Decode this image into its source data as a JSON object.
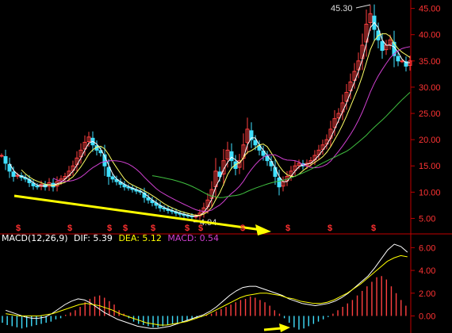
{
  "colors": {
    "background": "#000000",
    "axis": "#c00000",
    "axis_label": "#ff3333",
    "candle_up": "#ff4040",
    "candle_down": "#40e0ff",
    "ma_white": "#ffffff",
    "ma_yellow": "#ffff66",
    "ma_magenta": "#d040d0",
    "ma_green": "#40c040",
    "arrow": "#ffff00",
    "dif": "#ffffff",
    "dea": "#ffff00",
    "macd": "#d040d0"
  },
  "macd_header": {
    "name": "MACD(12,26,9)",
    "dif": "DIF: 5.39",
    "dea": "DEA: 5.12",
    "macd": "MACD: 0.54"
  },
  "chart_data": [
    {
      "type": "candlestick",
      "panel": "price",
      "ylim": [
        2.5,
        46
      ],
      "y_ticks": [
        "5.00",
        "10.00",
        "15.00",
        "20.00",
        "25.00",
        "30.00",
        "35.00",
        "40.00",
        "45.00"
      ],
      "annotations": [
        {
          "text": "45.30",
          "note": "high"
        },
        {
          "text": "4.94",
          "note": "low"
        }
      ],
      "markers": {
        "symbol": "$",
        "count": 11
      },
      "series": [
        {
          "name": "close",
          "x": [
            0,
            5,
            10,
            15,
            20,
            25,
            30,
            35,
            40,
            45,
            50,
            55,
            60,
            65,
            70,
            75,
            80,
            85,
            90,
            95,
            100,
            105,
            110,
            115,
            120,
            125,
            130,
            135,
            140,
            145,
            150,
            155,
            160,
            165,
            170,
            175,
            180,
            185,
            190,
            195,
            200,
            205,
            210,
            215,
            220,
            225,
            230,
            235,
            240,
            245,
            250,
            255,
            260,
            265,
            270,
            275,
            280,
            285,
            290,
            295,
            300,
            305,
            310,
            315,
            320,
            325,
            330,
            335,
            340,
            345,
            350,
            355,
            360,
            365,
            370,
            375,
            380,
            385,
            390,
            395,
            400,
            405,
            410,
            415,
            420,
            425,
            430,
            435,
            440,
            445,
            450,
            455,
            460,
            465,
            470,
            475,
            480,
            485,
            490,
            495,
            500,
            505,
            510,
            515
          ],
          "y": [
            17,
            15.5,
            14,
            13,
            13.2,
            12.8,
            12.5,
            11.8,
            11.2,
            11,
            11.5,
            11,
            11.8,
            11,
            12,
            12.5,
            13,
            14,
            15,
            16.5,
            18,
            19.5,
            20.5,
            19,
            18,
            17.5,
            15,
            13,
            12.5,
            12,
            11.5,
            11,
            10.8,
            10.5,
            10.2,
            10,
            9,
            8.5,
            8,
            7.5,
            7,
            6.8,
            6.5,
            6.3,
            6,
            5.8,
            5.6,
            5.5,
            5.3,
            5.4,
            6,
            7,
            8.5,
            10.5,
            14,
            13,
            16,
            18,
            16,
            14.5,
            16,
            19,
            22,
            20,
            19,
            18,
            17,
            16,
            15,
            13,
            11,
            12,
            13,
            14,
            15,
            15.5,
            15,
            15.5,
            16,
            17,
            18,
            19,
            20,
            22,
            24,
            25,
            27,
            29,
            31,
            33,
            35,
            38,
            42,
            44,
            41,
            39,
            37,
            38,
            39,
            36,
            35,
            35,
            34,
            35
          ]
        },
        {
          "name": "ma_white",
          "x": [],
          "y": []
        },
        {
          "name": "ma_yellow",
          "x": [],
          "y": []
        },
        {
          "name": "ma_magenta",
          "x": [],
          "y": []
        },
        {
          "name": "ma_green",
          "x": [],
          "y": []
        }
      ]
    },
    {
      "type": "bar+line",
      "panel": "macd",
      "ylim": [
        -1.5,
        7
      ],
      "y_ticks": [
        "0.00",
        "2.00",
        "4.00",
        "6.00"
      ],
      "histogram": [
        -0.6,
        -0.8,
        -0.9,
        -1,
        -1.1,
        -1,
        -0.9,
        -0.8,
        -0.7,
        -0.6,
        -0.5,
        -0.3,
        -0.2,
        0.1,
        0.3,
        0.5,
        0.8,
        1.2,
        1.5,
        1.7,
        1.8,
        1.6,
        1.3,
        1,
        0.5,
        0.2,
        -0.2,
        -0.5,
        -0.7,
        -0.8,
        -0.9,
        -1,
        -1,
        -0.9,
        -0.8,
        -0.7,
        -0.6,
        -0.5,
        -0.4,
        -0.3,
        -0.2,
        -0.1,
        0.1,
        0.2,
        0.4,
        0.6,
        0.8,
        1,
        1.2,
        1.4,
        1.5,
        1.7,
        1.6,
        1.4,
        1.2,
        0.9,
        0.5,
        0.2,
        -0.2,
        -0.6,
        -1,
        -1.2,
        -1.1,
        -0.9,
        -0.7,
        -0.5,
        -0.3,
        -0.1,
        0.2,
        0.5,
        0.8,
        1.1,
        1.4,
        1.8,
        2.2,
        2.6,
        3,
        3.4,
        3.5,
        3.2,
        2.6,
        2,
        1.4,
        0.9
      ],
      "dif": [
        0.5,
        0.3,
        0.1,
        -0.1,
        -0.2,
        -0.2,
        -0.1,
        0.2,
        0.6,
        1,
        1.3,
        1.5,
        1.4,
        1.1,
        0.7,
        0.3,
        0,
        -0.3,
        -0.5,
        -0.7,
        -0.9,
        -1,
        -1.1,
        -1.1,
        -1,
        -0.9,
        -0.7,
        -0.5,
        -0.3,
        -0.1,
        0.1,
        0.4,
        0.8,
        1.3,
        1.8,
        2.2,
        2.5,
        2.6,
        2.6,
        2.4,
        2.2,
        2,
        1.8,
        1.5,
        1.3,
        1.1,
        1,
        0.9,
        1,
        1.1,
        1.3,
        1.6,
        2,
        2.5,
        3,
        3.5,
        4.2,
        5,
        5.8,
        6.3,
        6.1,
        5.6
      ],
      "dea": [
        0.2,
        0.1,
        0,
        0,
        0,
        0,
        0.1,
        0.2,
        0.4,
        0.6,
        0.8,
        1,
        1.1,
        1,
        0.9,
        0.7,
        0.5,
        0.2,
        0,
        -0.2,
        -0.4,
        -0.6,
        -0.7,
        -0.8,
        -0.8,
        -0.7,
        -0.6,
        -0.5,
        -0.3,
        -0.1,
        0.1,
        0.4,
        0.7,
        1,
        1.3,
        1.6,
        1.8,
        1.9,
        2,
        2,
        1.9,
        1.8,
        1.6,
        1.5,
        1.3,
        1.2,
        1.1,
        1.1,
        1.2,
        1.4,
        1.7,
        2,
        2.4,
        2.8,
        3.3,
        3.8,
        4.3,
        4.8,
        5.1,
        5.3,
        5.2
      ]
    }
  ]
}
